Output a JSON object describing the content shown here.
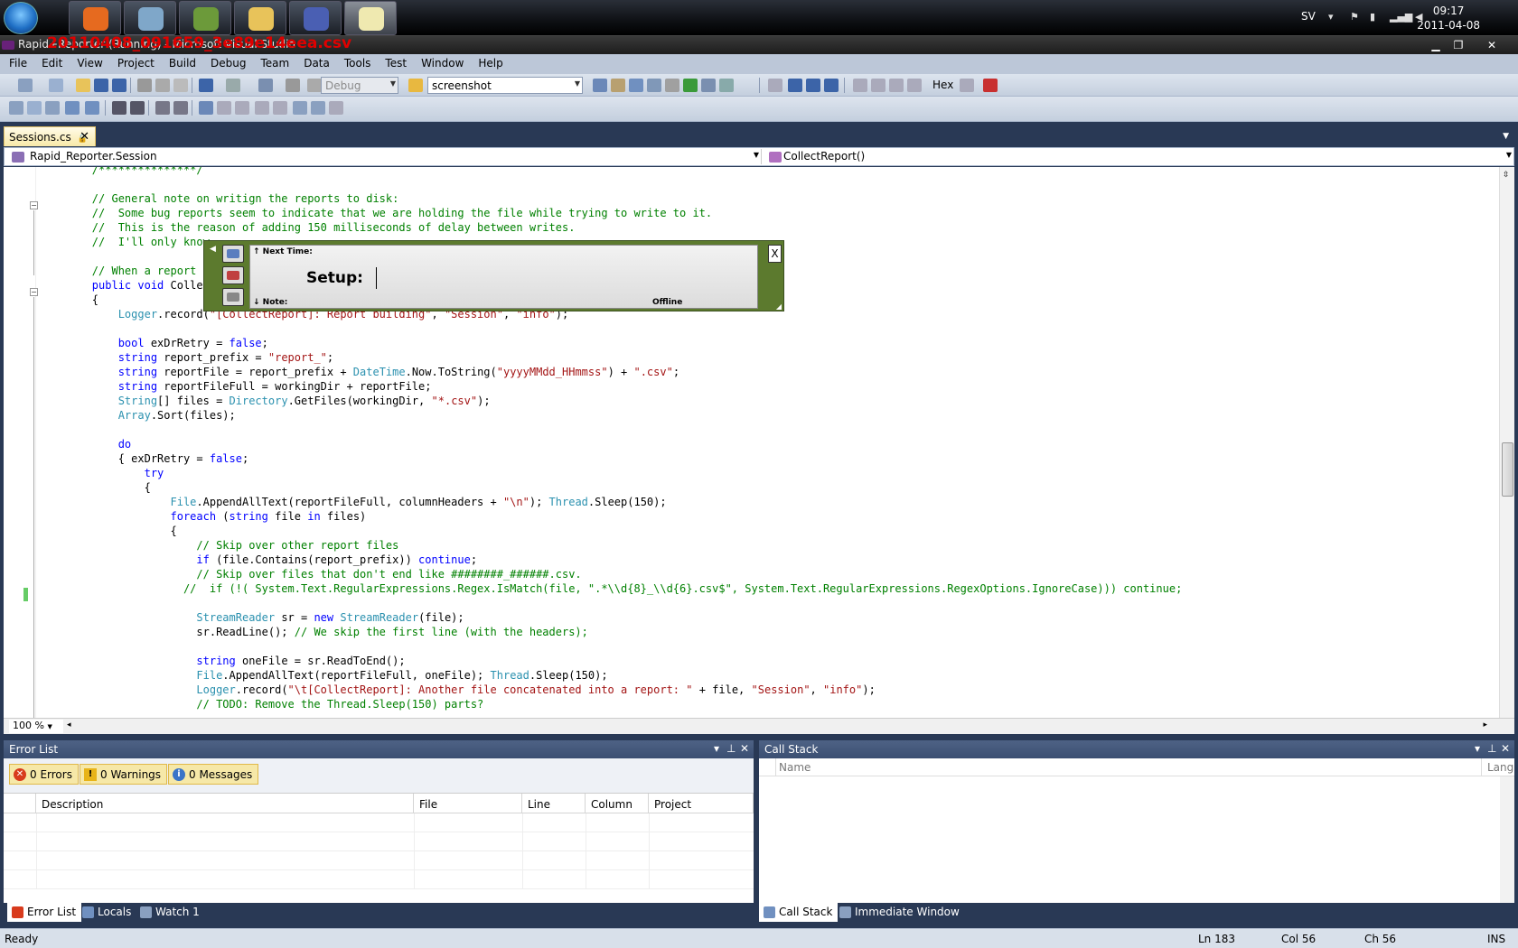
{
  "taskbar": {
    "language": "SV",
    "time": "09:17",
    "date": "2011-04-08",
    "apps": [
      {
        "icon": "firefox-icon",
        "color": "#e66a1f"
      },
      {
        "icon": "messenger-icon",
        "color": "#7fa7c9"
      },
      {
        "icon": "phone-app-icon",
        "color": "#6c9a3a"
      },
      {
        "icon": "folder-icon",
        "color": "#e8c35a"
      },
      {
        "icon": "infinity-app-icon",
        "color": "#4a5fb3"
      },
      {
        "icon": "notepad-icon",
        "color": "#efe9b0"
      }
    ]
  },
  "window": {
    "title": "Rapid+Reporter (Running) - Microsoft Visual Studio",
    "overlay_text": "20110408_091659_3e89e14eea.csv",
    "min": "▁",
    "restore": "❐",
    "close": "✕"
  },
  "menu": [
    "File",
    "Edit",
    "View",
    "Project",
    "Build",
    "Debug",
    "Team",
    "Data",
    "Tools",
    "Test",
    "Window",
    "Help"
  ],
  "toolbar": {
    "config": "Debug",
    "find": "screenshot",
    "hex": "Hex"
  },
  "document": {
    "tab": "Sessions.cs",
    "tab_pin": "🔒",
    "tab_close": "✕",
    "nav_left": "Rapid_Reporter.Session",
    "nav_right": "CollectReport()",
    "zoom": "100 %"
  },
  "code_lines": [
    [
      {
        "c": "c",
        "t": "        /***************/"
      }
    ],
    [
      {
        "c": "",
        "t": ""
      }
    ],
    [
      {
        "c": "c",
        "t": "        // General note on writign the reports to disk:"
      }
    ],
    [
      {
        "c": "c",
        "t": "        //  Some bug reports seem to indicate that we are holding the file while trying to write to it."
      }
    ],
    [
      {
        "c": "c",
        "t": "        //  This is the reason of adding 150 milliseconds of delay between writes."
      }
    ],
    [
      {
        "c": "c",
        "t": "        //  I'll only know"
      }
    ],
    [
      {
        "c": "",
        "t": ""
      }
    ],
    [
      {
        "c": "c",
        "t": "        // When a report c"
      }
    ],
    [
      {
        "c": "k",
        "t": "        public void "
      },
      {
        "c": "",
        "t": "Collec"
      }
    ],
    [
      {
        "c": "",
        "t": "        {"
      }
    ],
    [
      {
        "c": "t",
        "t": "            Logger"
      },
      {
        "c": "",
        "t": ".record("
      },
      {
        "c": "s",
        "t": "\"[CollectReport]: Report building\""
      },
      {
        "c": "",
        "t": ", "
      },
      {
        "c": "s",
        "t": "\"Session\""
      },
      {
        "c": "",
        "t": ", "
      },
      {
        "c": "s",
        "t": "\"info\""
      },
      {
        "c": "",
        "t": ");"
      }
    ],
    [
      {
        "c": "",
        "t": ""
      }
    ],
    [
      {
        "c": "k",
        "t": "            bool"
      },
      {
        "c": "",
        "t": " exDrRetry = "
      },
      {
        "c": "k",
        "t": "false"
      },
      {
        "c": "",
        "t": ";"
      }
    ],
    [
      {
        "c": "k",
        "t": "            string"
      },
      {
        "c": "",
        "t": " report_prefix = "
      },
      {
        "c": "s",
        "t": "\"report_\""
      },
      {
        "c": "",
        "t": ";"
      }
    ],
    [
      {
        "c": "k",
        "t": "            string"
      },
      {
        "c": "",
        "t": " reportFile = report_prefix + "
      },
      {
        "c": "t",
        "t": "DateTime"
      },
      {
        "c": "",
        "t": ".Now.ToString("
      },
      {
        "c": "s",
        "t": "\"yyyyMMdd_HHmmss\""
      },
      {
        "c": "",
        "t": ") + "
      },
      {
        "c": "s",
        "t": "\".csv\""
      },
      {
        "c": "",
        "t": ";"
      }
    ],
    [
      {
        "c": "k",
        "t": "            string"
      },
      {
        "c": "",
        "t": " reportFileFull = workingDir + reportFile;"
      }
    ],
    [
      {
        "c": "t",
        "t": "            String"
      },
      {
        "c": "",
        "t": "[] files = "
      },
      {
        "c": "t",
        "t": "Directory"
      },
      {
        "c": "",
        "t": ".GetFiles(workingDir, "
      },
      {
        "c": "s",
        "t": "\"*.csv\""
      },
      {
        "c": "",
        "t": ");"
      }
    ],
    [
      {
        "c": "t",
        "t": "            Array"
      },
      {
        "c": "",
        "t": ".Sort(files);"
      }
    ],
    [
      {
        "c": "",
        "t": ""
      }
    ],
    [
      {
        "c": "k",
        "t": "            do"
      }
    ],
    [
      {
        "c": "",
        "t": "            { exDrRetry = "
      },
      {
        "c": "k",
        "t": "false"
      },
      {
        "c": "",
        "t": ";"
      }
    ],
    [
      {
        "c": "k",
        "t": "                try"
      }
    ],
    [
      {
        "c": "",
        "t": "                {"
      }
    ],
    [
      {
        "c": "t",
        "t": "                    File"
      },
      {
        "c": "",
        "t": ".AppendAllText(reportFileFull, columnHeaders + "
      },
      {
        "c": "s",
        "t": "\"\\n\""
      },
      {
        "c": "",
        "t": "); "
      },
      {
        "c": "t",
        "t": "Thread"
      },
      {
        "c": "",
        "t": ".Sleep(150);"
      }
    ],
    [
      {
        "c": "k",
        "t": "                    foreach"
      },
      {
        "c": "",
        "t": " ("
      },
      {
        "c": "k",
        "t": "string"
      },
      {
        "c": "",
        "t": " file "
      },
      {
        "c": "k",
        "t": "in"
      },
      {
        "c": "",
        "t": " files)"
      }
    ],
    [
      {
        "c": "",
        "t": "                    {"
      }
    ],
    [
      {
        "c": "c",
        "t": "                        // Skip over other report files"
      }
    ],
    [
      {
        "c": "k",
        "t": "                        if"
      },
      {
        "c": "",
        "t": " (file.Contains(report_prefix)) "
      },
      {
        "c": "k",
        "t": "continue"
      },
      {
        "c": "",
        "t": ";"
      }
    ],
    [
      {
        "c": "c",
        "t": "                        // Skip over files that don't end like ########_######.csv."
      }
    ],
    [
      {
        "c": "c",
        "t": "                      //  if (!( System.Text.RegularExpressions.Regex.IsMatch(file, \".*\\\\d{8}_\\\\d{6}.csv$\", System.Text.RegularExpressions.RegexOptions.IgnoreCase))) continue;"
      }
    ],
    [
      {
        "c": "",
        "t": ""
      }
    ],
    [
      {
        "c": "t",
        "t": "                        StreamReader"
      },
      {
        "c": "",
        "t": " sr = "
      },
      {
        "c": "k",
        "t": "new"
      },
      {
        "c": "t",
        "t": " StreamReader"
      },
      {
        "c": "",
        "t": "(file);"
      }
    ],
    [
      {
        "c": "",
        "t": "                        sr.ReadLine(); "
      },
      {
        "c": "c",
        "t": "// We skip the first line (with the headers);"
      }
    ],
    [
      {
        "c": "",
        "t": ""
      }
    ],
    [
      {
        "c": "k",
        "t": "                        string"
      },
      {
        "c": "",
        "t": " oneFile = sr.ReadToEnd();"
      }
    ],
    [
      {
        "c": "t",
        "t": "                        File"
      },
      {
        "c": "",
        "t": ".AppendAllText(reportFileFull, oneFile); "
      },
      {
        "c": "t",
        "t": "Thread"
      },
      {
        "c": "",
        "t": ".Sleep(150);"
      }
    ],
    [
      {
        "c": "t",
        "t": "                        Logger"
      },
      {
        "c": "",
        "t": ".record("
      },
      {
        "c": "s",
        "t": "\"\\t[CollectReport]: Another file concatenated into a report: \""
      },
      {
        "c": "",
        "t": " + file, "
      },
      {
        "c": "s",
        "t": "\"Session\""
      },
      {
        "c": "",
        "t": ", "
      },
      {
        "c": "s",
        "t": "\"info\""
      },
      {
        "c": "",
        "t": ");"
      }
    ],
    [
      {
        "c": "c",
        "t": "                        // TODO: Remove the Thread.Sleep(150) parts?"
      }
    ]
  ],
  "rapid_reporter": {
    "next_time": "↑ Next Time:",
    "setup_label": "Setup:",
    "note": "↓ Note:",
    "status": "Offline",
    "close": "X"
  },
  "error_list": {
    "title": "Error List",
    "errors": "0 Errors",
    "warnings": "0 Warnings",
    "messages": "0 Messages",
    "columns": [
      "Description",
      "File",
      "Line",
      "Column",
      "Project"
    ]
  },
  "call_stack": {
    "title": "Call Stack",
    "columns": [
      "Name",
      "Lang"
    ]
  },
  "bottom_tabs_left": [
    "Error List",
    "Locals",
    "Watch 1"
  ],
  "bottom_tabs_right": [
    "Call Stack",
    "Immediate Window"
  ],
  "status": {
    "ready": "Ready",
    "ln": "Ln 183",
    "col": "Col 56",
    "ch": "Ch 56",
    "ins": "INS"
  }
}
